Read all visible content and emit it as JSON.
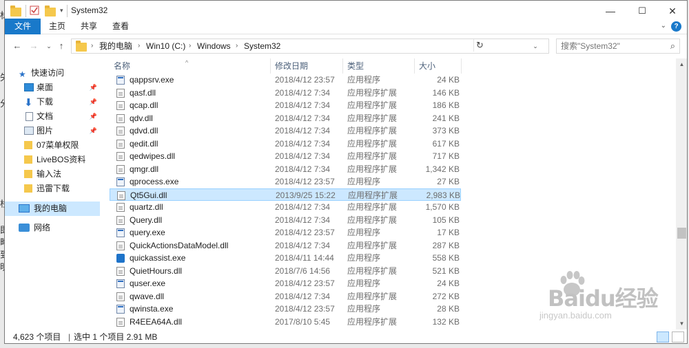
{
  "window": {
    "title": "System32",
    "controls": {
      "minimize": "—",
      "maximize": "☐",
      "close": "✕"
    }
  },
  "ribbon": {
    "tabs": [
      "文件",
      "主页",
      "共享",
      "查看"
    ],
    "help": "?"
  },
  "address": {
    "crumbs": [
      "我的电脑",
      "Win10 (C:)",
      "Windows",
      "System32"
    ]
  },
  "search": {
    "placeholder": "搜索\"System32\""
  },
  "navpane": {
    "items": [
      {
        "label": "快速访问",
        "icon": "star-icon",
        "pinned": false
      },
      {
        "label": "桌面",
        "icon": "desktop-icon",
        "pinned": true
      },
      {
        "label": "下载",
        "icon": "download-icon",
        "pinned": true
      },
      {
        "label": "文档",
        "icon": "document-icon",
        "pinned": true
      },
      {
        "label": "图片",
        "icon": "picture-icon",
        "pinned": true
      },
      {
        "label": "07菜单权限",
        "icon": "folder-icon",
        "pinned": false
      },
      {
        "label": "LiveBOS资料",
        "icon": "folder-icon",
        "pinned": false
      },
      {
        "label": "输入法",
        "icon": "folder-icon",
        "pinned": false
      },
      {
        "label": "迅雷下载",
        "icon": "folder-icon",
        "pinned": false
      },
      {
        "label": "我的电脑",
        "icon": "computer-icon",
        "pinned": false
      },
      {
        "label": "网络",
        "icon": "network-icon",
        "pinned": false
      }
    ]
  },
  "columns": {
    "name": "名称",
    "date": "修改日期",
    "type": "类型",
    "size": "大小"
  },
  "files": [
    {
      "name": "qappsrv.exe",
      "date": "2018/4/12 23:57",
      "type": "应用程序",
      "size": "24 KB",
      "kind": "exe"
    },
    {
      "name": "qasf.dll",
      "date": "2018/4/12 7:34",
      "type": "应用程序扩展",
      "size": "146 KB",
      "kind": "dll"
    },
    {
      "name": "qcap.dll",
      "date": "2018/4/12 7:34",
      "type": "应用程序扩展",
      "size": "186 KB",
      "kind": "dll"
    },
    {
      "name": "qdv.dll",
      "date": "2018/4/12 7:34",
      "type": "应用程序扩展",
      "size": "241 KB",
      "kind": "dll"
    },
    {
      "name": "qdvd.dll",
      "date": "2018/4/12 7:34",
      "type": "应用程序扩展",
      "size": "373 KB",
      "kind": "dll"
    },
    {
      "name": "qedit.dll",
      "date": "2018/4/12 7:34",
      "type": "应用程序扩展",
      "size": "617 KB",
      "kind": "dll"
    },
    {
      "name": "qedwipes.dll",
      "date": "2018/4/12 7:34",
      "type": "应用程序扩展",
      "size": "717 KB",
      "kind": "dll"
    },
    {
      "name": "qmgr.dll",
      "date": "2018/4/12 7:34",
      "type": "应用程序扩展",
      "size": "1,342 KB",
      "kind": "dll"
    },
    {
      "name": "qprocess.exe",
      "date": "2018/4/12 23:57",
      "type": "应用程序",
      "size": "27 KB",
      "kind": "exe"
    },
    {
      "name": "Qt5Gui.dll",
      "date": "2013/9/25 15:22",
      "type": "应用程序扩展",
      "size": "2,983 KB",
      "kind": "dll",
      "selected": true
    },
    {
      "name": "quartz.dll",
      "date": "2018/4/12 7:34",
      "type": "应用程序扩展",
      "size": "1,570 KB",
      "kind": "dll"
    },
    {
      "name": "Query.dll",
      "date": "2018/4/12 7:34",
      "type": "应用程序扩展",
      "size": "105 KB",
      "kind": "dll"
    },
    {
      "name": "query.exe",
      "date": "2018/4/12 23:57",
      "type": "应用程序",
      "size": "17 KB",
      "kind": "exe"
    },
    {
      "name": "QuickActionsDataModel.dll",
      "date": "2018/4/12 7:34",
      "type": "应用程序扩展",
      "size": "287 KB",
      "kind": "dll"
    },
    {
      "name": "quickassist.exe",
      "date": "2018/4/11 14:44",
      "type": "应用程序",
      "size": "558 KB",
      "kind": "qa"
    },
    {
      "name": "QuietHours.dll",
      "date": "2018/7/6 14:56",
      "type": "应用程序扩展",
      "size": "521 KB",
      "kind": "dll"
    },
    {
      "name": "quser.exe",
      "date": "2018/4/12 23:57",
      "type": "应用程序",
      "size": "24 KB",
      "kind": "exe"
    },
    {
      "name": "qwave.dll",
      "date": "2018/4/12 7:34",
      "type": "应用程序扩展",
      "size": "272 KB",
      "kind": "dll"
    },
    {
      "name": "qwinsta.exe",
      "date": "2018/4/12 23:57",
      "type": "应用程序",
      "size": "28 KB",
      "kind": "exe"
    },
    {
      "name": "R4EEA64A.dll",
      "date": "2017/8/10 5:45",
      "type": "应用程序扩展",
      "size": "132 KB",
      "kind": "dll"
    }
  ],
  "status": {
    "count": "4,623 个项目",
    "selection": "选中 1 个项目  2.91 MB"
  },
  "watermark": {
    "brand": "Baidu经验",
    "url": "jingyan.baidu.com"
  },
  "background_chars": [
    "标",
    "失",
    "分",
    "栈",
    "即",
    "略",
    "到",
    "明"
  ]
}
